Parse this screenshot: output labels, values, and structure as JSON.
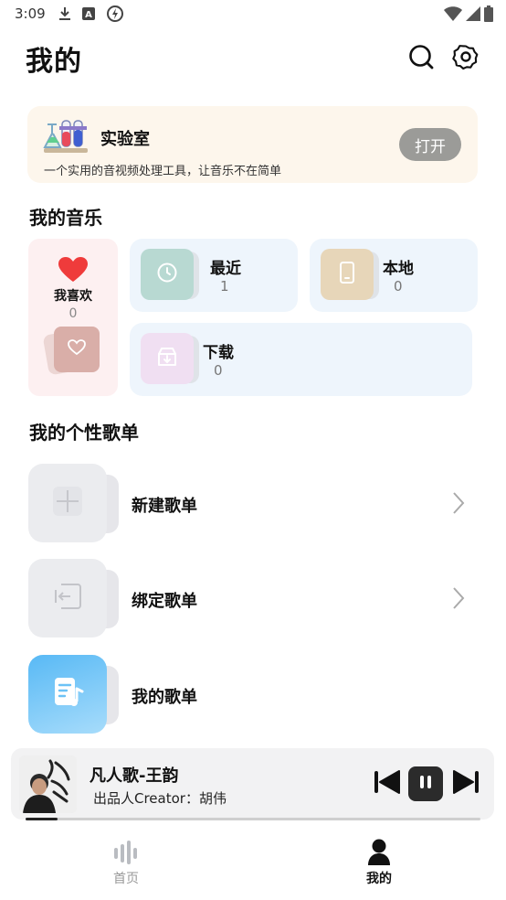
{
  "status_bar": {
    "time": "3:09",
    "icons": [
      "download-icon",
      "a-notification-icon",
      "speed-icon",
      "wifi-icon",
      "signal-icon",
      "battery-icon"
    ]
  },
  "header": {
    "title": "我的",
    "icons": [
      "search-icon",
      "settings-icon"
    ]
  },
  "lab": {
    "title": "实验室",
    "description": "一个实用的音视频处理工具，让音乐不在简单",
    "button": "打开"
  },
  "my_music": {
    "title": "我的音乐",
    "favorites": {
      "label": "我喜欢",
      "count": "0"
    },
    "recent": {
      "label": "最近",
      "count": "1"
    },
    "local": {
      "label": "本地",
      "count": "0"
    },
    "downloads": {
      "label": "下载",
      "count": "0"
    }
  },
  "playlists": {
    "title": "我的个性歌单",
    "items": [
      {
        "label": "新建歌单"
      },
      {
        "label": "绑定歌单"
      },
      {
        "label": "我的歌单"
      }
    ]
  },
  "player": {
    "title": "凡人歌-王韵",
    "artist": "出品人Creator：胡伟",
    "progress": 0.07
  },
  "nav": {
    "items": [
      {
        "label": "首页"
      },
      {
        "label": "我的"
      }
    ],
    "active": "我的"
  },
  "colors": {
    "lab_bg": "#fdf6ec",
    "fav_bg": "#fdf0f1",
    "tile_bg": "#eef5fc",
    "heart": "#ef3b3b",
    "recent_icon_bg": "#b8d9d2",
    "local_icon_bg": "#e7d6b9",
    "download_icon_bg": "#f0dff2",
    "my_playlist_gradient": "#7ec8f6"
  }
}
